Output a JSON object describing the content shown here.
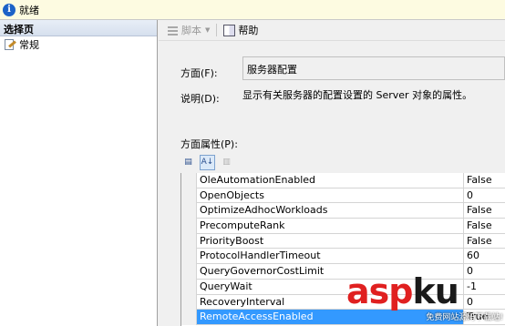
{
  "status": {
    "text": "就绪"
  },
  "left_panel": {
    "header": "选择页",
    "items": [
      {
        "label": "常规"
      }
    ]
  },
  "toolbar": {
    "script_label": "脚本",
    "help_label": "帮助"
  },
  "facet": {
    "label": "方面(F):",
    "value": "服务器配置"
  },
  "description": {
    "label": "说明(D):",
    "text": "显示有关服务器的配置设置的 Server 对象的属性。"
  },
  "properties": {
    "label": "方面属性(P):",
    "rows": [
      {
        "name": "OleAutomationEnabled",
        "value": "False"
      },
      {
        "name": "OpenObjects",
        "value": "0"
      },
      {
        "name": "OptimizeAdhocWorkloads",
        "value": "False"
      },
      {
        "name": "PrecomputeRank",
        "value": "False"
      },
      {
        "name": "PriorityBoost",
        "value": "False"
      },
      {
        "name": "ProtocolHandlerTimeout",
        "value": "60"
      },
      {
        "name": "QueryGovernorCostLimit",
        "value": "0"
      },
      {
        "name": "QueryWait",
        "value": "-1"
      },
      {
        "name": "RecoveryInterval",
        "value": "0"
      },
      {
        "name": "RemoteAccessEnabled",
        "value": "True"
      }
    ]
  },
  "watermark": {
    "main_red": "asp",
    "main_dark": "ku",
    "sub": "免费网站源码下载站!"
  }
}
